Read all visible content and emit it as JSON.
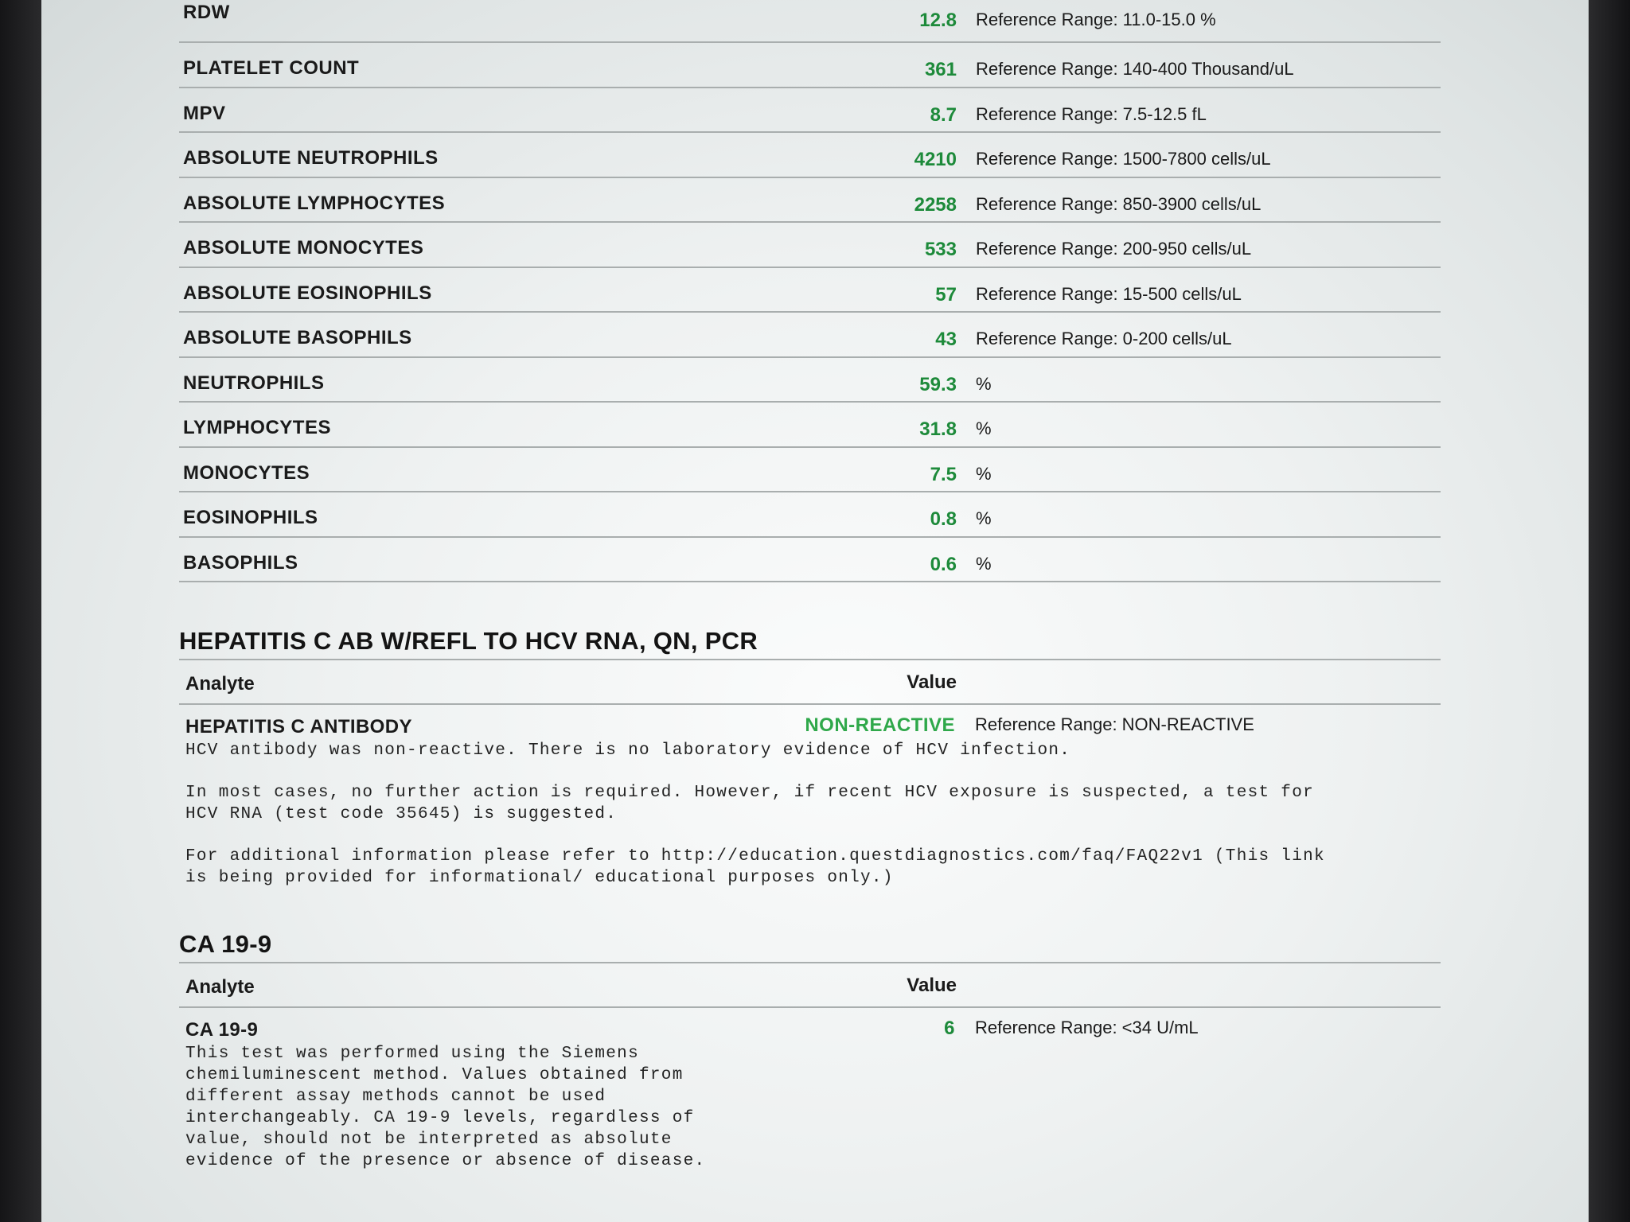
{
  "cbc_rows": [
    {
      "name": "RDW",
      "value": "12.8",
      "ref": "Reference Range: 11.0-15.0 %"
    },
    {
      "name": "PLATELET COUNT",
      "value": "361",
      "ref": "Reference Range: 140-400 Thousand/uL"
    },
    {
      "name": "MPV",
      "value": "8.7",
      "ref": "Reference Range: 7.5-12.5 fL"
    },
    {
      "name": "ABSOLUTE NEUTROPHILS",
      "value": "4210",
      "ref": "Reference Range: 1500-7800 cells/uL"
    },
    {
      "name": "ABSOLUTE LYMPHOCYTES",
      "value": "2258",
      "ref": "Reference Range: 850-3900 cells/uL"
    },
    {
      "name": "ABSOLUTE MONOCYTES",
      "value": "533",
      "ref": "Reference Range: 200-950 cells/uL"
    },
    {
      "name": "ABSOLUTE EOSINOPHILS",
      "value": "57",
      "ref": "Reference Range: 15-500 cells/uL"
    },
    {
      "name": "ABSOLUTE BASOPHILS",
      "value": "43",
      "ref": "Reference Range: 0-200 cells/uL"
    },
    {
      "name": "NEUTROPHILS",
      "value": "59.3",
      "ref": "%"
    },
    {
      "name": "LYMPHOCYTES",
      "value": "31.8",
      "ref": "%"
    },
    {
      "name": "MONOCYTES",
      "value": "7.5",
      "ref": "%"
    },
    {
      "name": "EOSINOPHILS",
      "value": "0.8",
      "ref": "%"
    },
    {
      "name": "BASOPHILS",
      "value": "0.6",
      "ref": "%"
    }
  ],
  "hepc": {
    "title": "HEPATITIS C AB W/REFL TO HCV RNA, QN, PCR",
    "header_analyte": "Analyte",
    "header_value": "Value",
    "analyte": "HEPATITIS C ANTIBODY",
    "value": "NON-REACTIVE",
    "ref": "Reference Range: NON-REACTIVE",
    "note1": "HCV antibody was non-reactive. There is no laboratory evidence of HCV infection.",
    "note2": "In most cases, no further action is required. However, if recent HCV exposure is suspected, a test for\nHCV RNA (test code 35645) is suggested.",
    "note3": "For additional information please refer to http://education.questdiagnostics.com/faq/FAQ22v1 (This link\nis being provided for informational/ educational purposes only.)"
  },
  "ca199": {
    "title": "CA 19-9",
    "header_analyte": "Analyte",
    "header_value": "Value",
    "analyte": "CA 19-9",
    "value": "6",
    "ref": "Reference Range: <34 U/mL",
    "note": "This test was performed using the Siemens\nchemiluminescent method. Values obtained from\ndifferent assay methods cannot be used\ninterchangeably. CA 19-9 levels, regardless of\nvalue, should not be interpreted as absolute\nevidence of the presence or absence of disease."
  },
  "colors": {
    "value_green": "#1d8a3a",
    "nonreactive_green": "#2fa84a"
  }
}
